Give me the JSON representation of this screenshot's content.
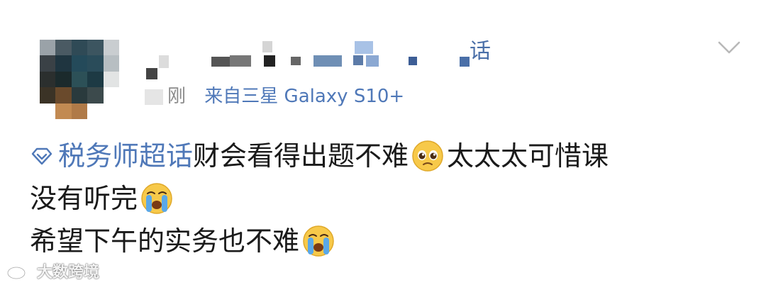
{
  "post": {
    "username_suffix": "话",
    "meta": {
      "time": "刚",
      "device": "来自三星 Galaxy S10+"
    },
    "content": {
      "topic": "税务师超话",
      "line1_text": "财会看得出题不难",
      "line1_after_emoji": "太太太可惜课",
      "line2_text": "没有听完",
      "line3_text": "希望下午的实务也不难"
    },
    "icons": {
      "topic": "diamond-topic-icon",
      "emoji_pleading": "pleading-face-emoji",
      "emoji_crying": "loudly-crying-face-emoji",
      "chevron": "chevron-down-icon"
    },
    "colors": {
      "link": "#4f78b8",
      "meta_gray": "#8a8a8a",
      "text": "#1a1a1a"
    }
  },
  "watermark": {
    "text": "大数跨境"
  }
}
